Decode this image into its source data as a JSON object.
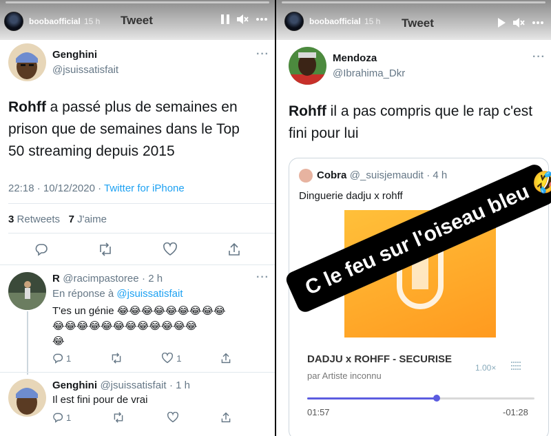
{
  "story": {
    "username": "boobaofficial",
    "time": "15 h",
    "title": "Tweet"
  },
  "left_tweet": {
    "name": "Genghini",
    "handle": "@jsuissatisfait",
    "text_bold": "Rohff",
    "text_line1": " a passé plus de semaines en",
    "text_line2": "prison que de semaines dans le Top",
    "text_line3": "50 streaming depuis 2015",
    "datetime": "22:18 · 10/12/2020 · ",
    "source": "Twitter for iPhone",
    "retweets_count": "3",
    "retweets_label": "Retweets",
    "likes_count": "7",
    "likes_label": "J'aime"
  },
  "reply1": {
    "name": "R",
    "handle": "@racimpastoree",
    "time": "· 2 h",
    "in_reply_prefix": "En réponse à ",
    "in_reply_mention": "@jsuissatisfait",
    "text": "T'es un génie",
    "emoji_row1": "😂😂😂😂😂😂😂😂😂",
    "emoji_row2": "😂😂😂😂😂😂😂😂😂😂😂😂",
    "emoji_row3": "😂",
    "reply_count": "1",
    "like_count": "1"
  },
  "reply2": {
    "name": "Genghini",
    "handle": "@jsuissatisfait",
    "time": "· 1 h",
    "text": "Il est fini pour de vrai",
    "reply_count": "1"
  },
  "right_tweet": {
    "name": "Mendoza",
    "handle": "@Ibrahima_Dkr",
    "text_bold": "Rohff",
    "text_line1": " il a pas compris que le rap c'est",
    "text_line2": "fini pour lui"
  },
  "quote": {
    "name": "Cobra",
    "handle": "@_suisjemaudit",
    "time": "· 4 h",
    "text": "Dinguerie dadju x rohff",
    "track": "DADJU x ROHFF - SECURISE",
    "artist": "par Artiste inconnu",
    "speed": "1.00×",
    "elapsed": "01:57",
    "remaining": "-01:28",
    "progress": 0.57
  },
  "sticker": {
    "text": "C le feu sur l'oiseau bleu 🤣🥶"
  }
}
